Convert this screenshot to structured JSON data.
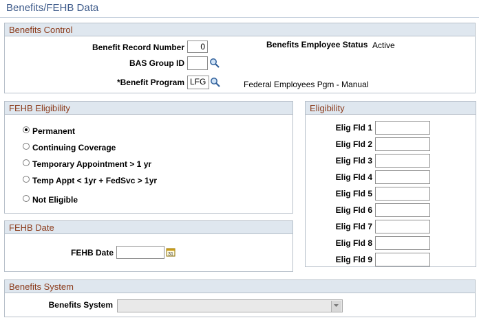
{
  "page": {
    "title": "Benefits/FEHB Data"
  },
  "benefits_control": {
    "header": "Benefits Control",
    "record_number_label": "Benefit Record Number",
    "record_number_value": "0",
    "employee_status_label": "Benefits Employee Status",
    "employee_status_value": "Active",
    "bas_group_label": "BAS Group ID",
    "bas_group_value": "",
    "program_label": "*Benefit Program",
    "program_value": "LFG",
    "program_description": "Federal Employees Pgm - Manual"
  },
  "fehb_eligibility": {
    "header": "FEHB Eligibility",
    "options": [
      {
        "label": "Permanent",
        "selected": true
      },
      {
        "label": "Continuing Coverage",
        "selected": false
      },
      {
        "label": "Temporary Appointment > 1 yr",
        "selected": false
      },
      {
        "label": "Temp Appt < 1yr + FedSvc > 1yr",
        "selected": false
      },
      {
        "label": "Not Eligible",
        "selected": false
      }
    ]
  },
  "fehb_date": {
    "header": "FEHB Date",
    "label": "FEHB Date",
    "value": ""
  },
  "eligibility": {
    "header": "Eligibility",
    "fields": [
      {
        "label": "Elig Fld 1",
        "value": ""
      },
      {
        "label": "Elig Fld 2",
        "value": ""
      },
      {
        "label": "Elig Fld 3",
        "value": ""
      },
      {
        "label": "Elig Fld 4",
        "value": ""
      },
      {
        "label": "Elig Fld 5",
        "value": ""
      },
      {
        "label": "Elig Fld 6",
        "value": ""
      },
      {
        "label": "Elig Fld 7",
        "value": ""
      },
      {
        "label": "Elig Fld 8",
        "value": ""
      },
      {
        "label": "Elig Fld 9",
        "value": ""
      }
    ]
  },
  "benefits_system": {
    "header": "Benefits System",
    "label": "Benefits System",
    "value": ""
  },
  "icons": {
    "lookup": "magnifier-icon",
    "calendar": "calendar-icon",
    "dropdown": "chevron-down-icon"
  },
  "colors": {
    "header_bg": "#dfe7ef",
    "header_text": "#8b3a1a",
    "title_text": "#3d5a8a"
  }
}
